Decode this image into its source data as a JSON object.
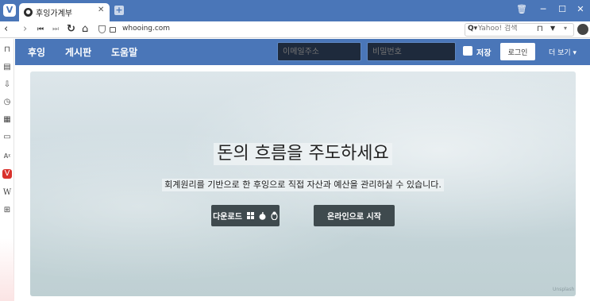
{
  "browser": {
    "tab": {
      "title": "후잉가계부"
    },
    "address": {
      "url": "whooing.com",
      "search_placeholder": "Yahoo! 검색"
    }
  },
  "site": {
    "nav": {
      "links": [
        "후잉",
        "게시판",
        "도움말"
      ],
      "email_placeholder": "이메일주소",
      "password_placeholder": "비밀번호",
      "remember_label": "저장",
      "login_button": "로그인",
      "more_label": "더 보기 ▾"
    },
    "hero": {
      "title": "돈의 흐름을 주도하세요",
      "subtitle": "회계원리를 기반으로 한 후잉으로 직접 자산과 예산을 관리하실 수 있습니다.",
      "download_button": "다운로드",
      "online_button": "온라인으로 시작",
      "credit": "Unsplash"
    }
  },
  "colors": {
    "brand": "#4a76b8",
    "hero_button": "#3f4a4e"
  }
}
